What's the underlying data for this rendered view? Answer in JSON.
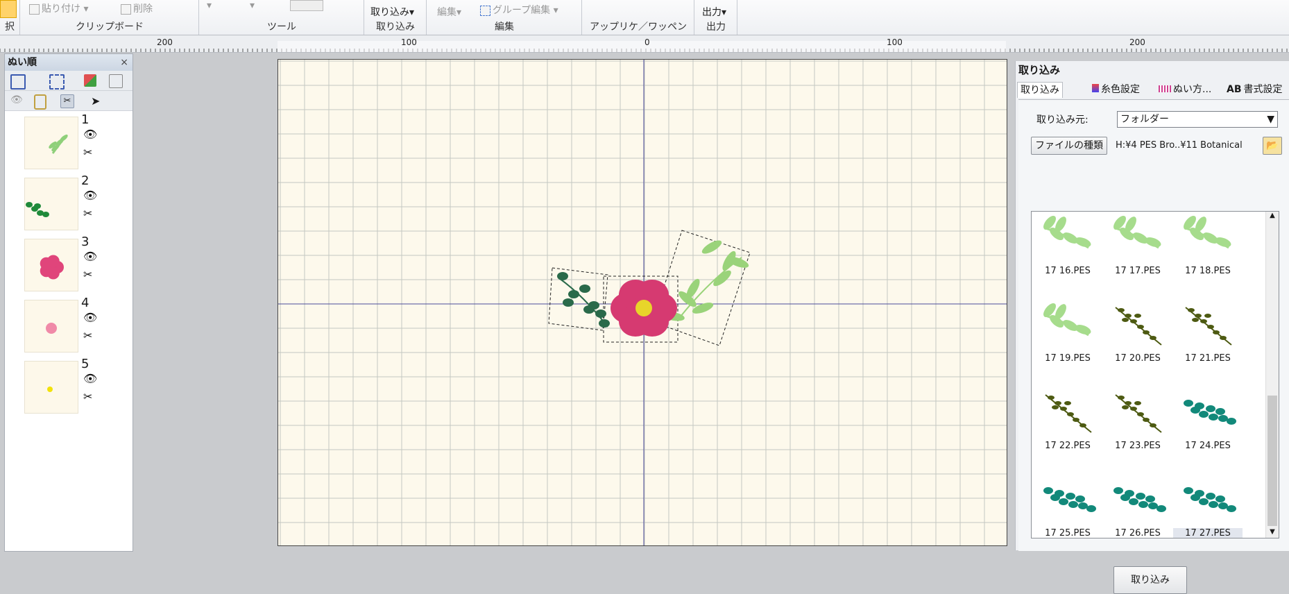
{
  "ribbon": {
    "paste": "貼り付け",
    "delete": "削除",
    "import_btn": "取り込み",
    "option_edit": "編集",
    "group_edit": "グループ編集",
    "output": "出力",
    "groups": [
      "択",
      "クリップボード",
      "ツール",
      "取り込み",
      "編集",
      "アップリケ／ワッペン",
      "出力"
    ]
  },
  "ruler": {
    "labels": [
      "200",
      "100",
      "0",
      "100",
      "200"
    ]
  },
  "sew_order": {
    "title": "ぬい順",
    "close": "×",
    "items": [
      {
        "number": "1",
        "color": "#8fd07a",
        "shape": "sprig"
      },
      {
        "number": "2",
        "color": "#1f8a3a",
        "shape": "leaf-branch"
      },
      {
        "number": "3",
        "color": "#e0457b",
        "shape": "flower"
      },
      {
        "number": "4",
        "color": "#f08aa8",
        "shape": "small-flower"
      },
      {
        "number": "5",
        "color": "#f2e20a",
        "shape": "dot"
      }
    ],
    "eye_icon": "👁",
    "scissors_icon": "✂"
  },
  "import_panel": {
    "title": "取り込み",
    "tabs": [
      "取り込み",
      "糸色設定",
      "ぬい方...",
      "書式設定"
    ],
    "source_label": "取り込み元:",
    "source_value": "フォルダー",
    "file_type_button": "ファイルの種類",
    "path": "H:¥4 PES  Bro..¥11 Botanical",
    "import_button": "取り込み",
    "files": [
      {
        "name": "17 16.PES",
        "color": "#a6dc8c",
        "kind": "sprig"
      },
      {
        "name": "17 17.PES",
        "color": "#a6dc8c",
        "kind": "sprig"
      },
      {
        "name": "17 18.PES",
        "color": "#a6dc8c",
        "kind": "sprig"
      },
      {
        "name": "17 19.PES",
        "color": "#a6dc8c",
        "kind": "sprig"
      },
      {
        "name": "17 20.PES",
        "color": "#4d5a12",
        "kind": "stem"
      },
      {
        "name": "17 21.PES",
        "color": "#4d5a12",
        "kind": "stem"
      },
      {
        "name": "17 22.PES",
        "color": "#4d5a12",
        "kind": "stem"
      },
      {
        "name": "17 23.PES",
        "color": "#4d5a12",
        "kind": "stem"
      },
      {
        "name": "17 24.PES",
        "color": "#12897a",
        "kind": "branch"
      },
      {
        "name": "17 25.PES",
        "color": "#12897a",
        "kind": "branch"
      },
      {
        "name": "17 26.PES",
        "color": "#12897a",
        "kind": "branch"
      },
      {
        "name": "17 27.PES",
        "color": "#12897a",
        "kind": "branch"
      }
    ]
  },
  "colors": {
    "canvas": "#fdf9ec",
    "grid": "#c4c7c2",
    "axis": "#4a4a9a",
    "flower": "#d63a71",
    "leaf_dark": "#2a6a4a",
    "leaf_light": "#9ad37a"
  }
}
